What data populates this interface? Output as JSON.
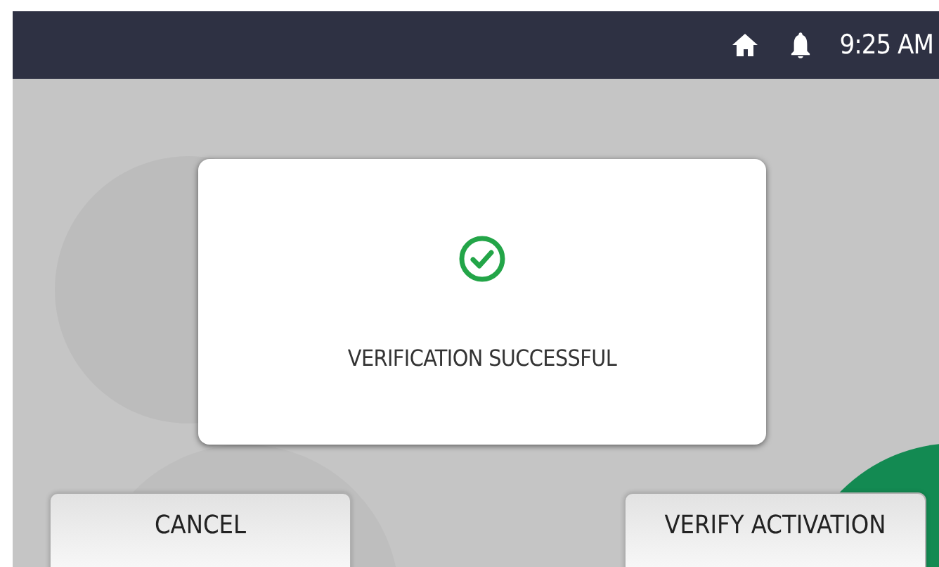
{
  "status_bar": {
    "time": "9:25 AM"
  },
  "dialog": {
    "message": "VERIFICATION SUCCESSFUL"
  },
  "buttons": [
    {
      "label": "CANCEL"
    },
    {
      "label": "VERIFY ACTIVATION"
    }
  ]
}
